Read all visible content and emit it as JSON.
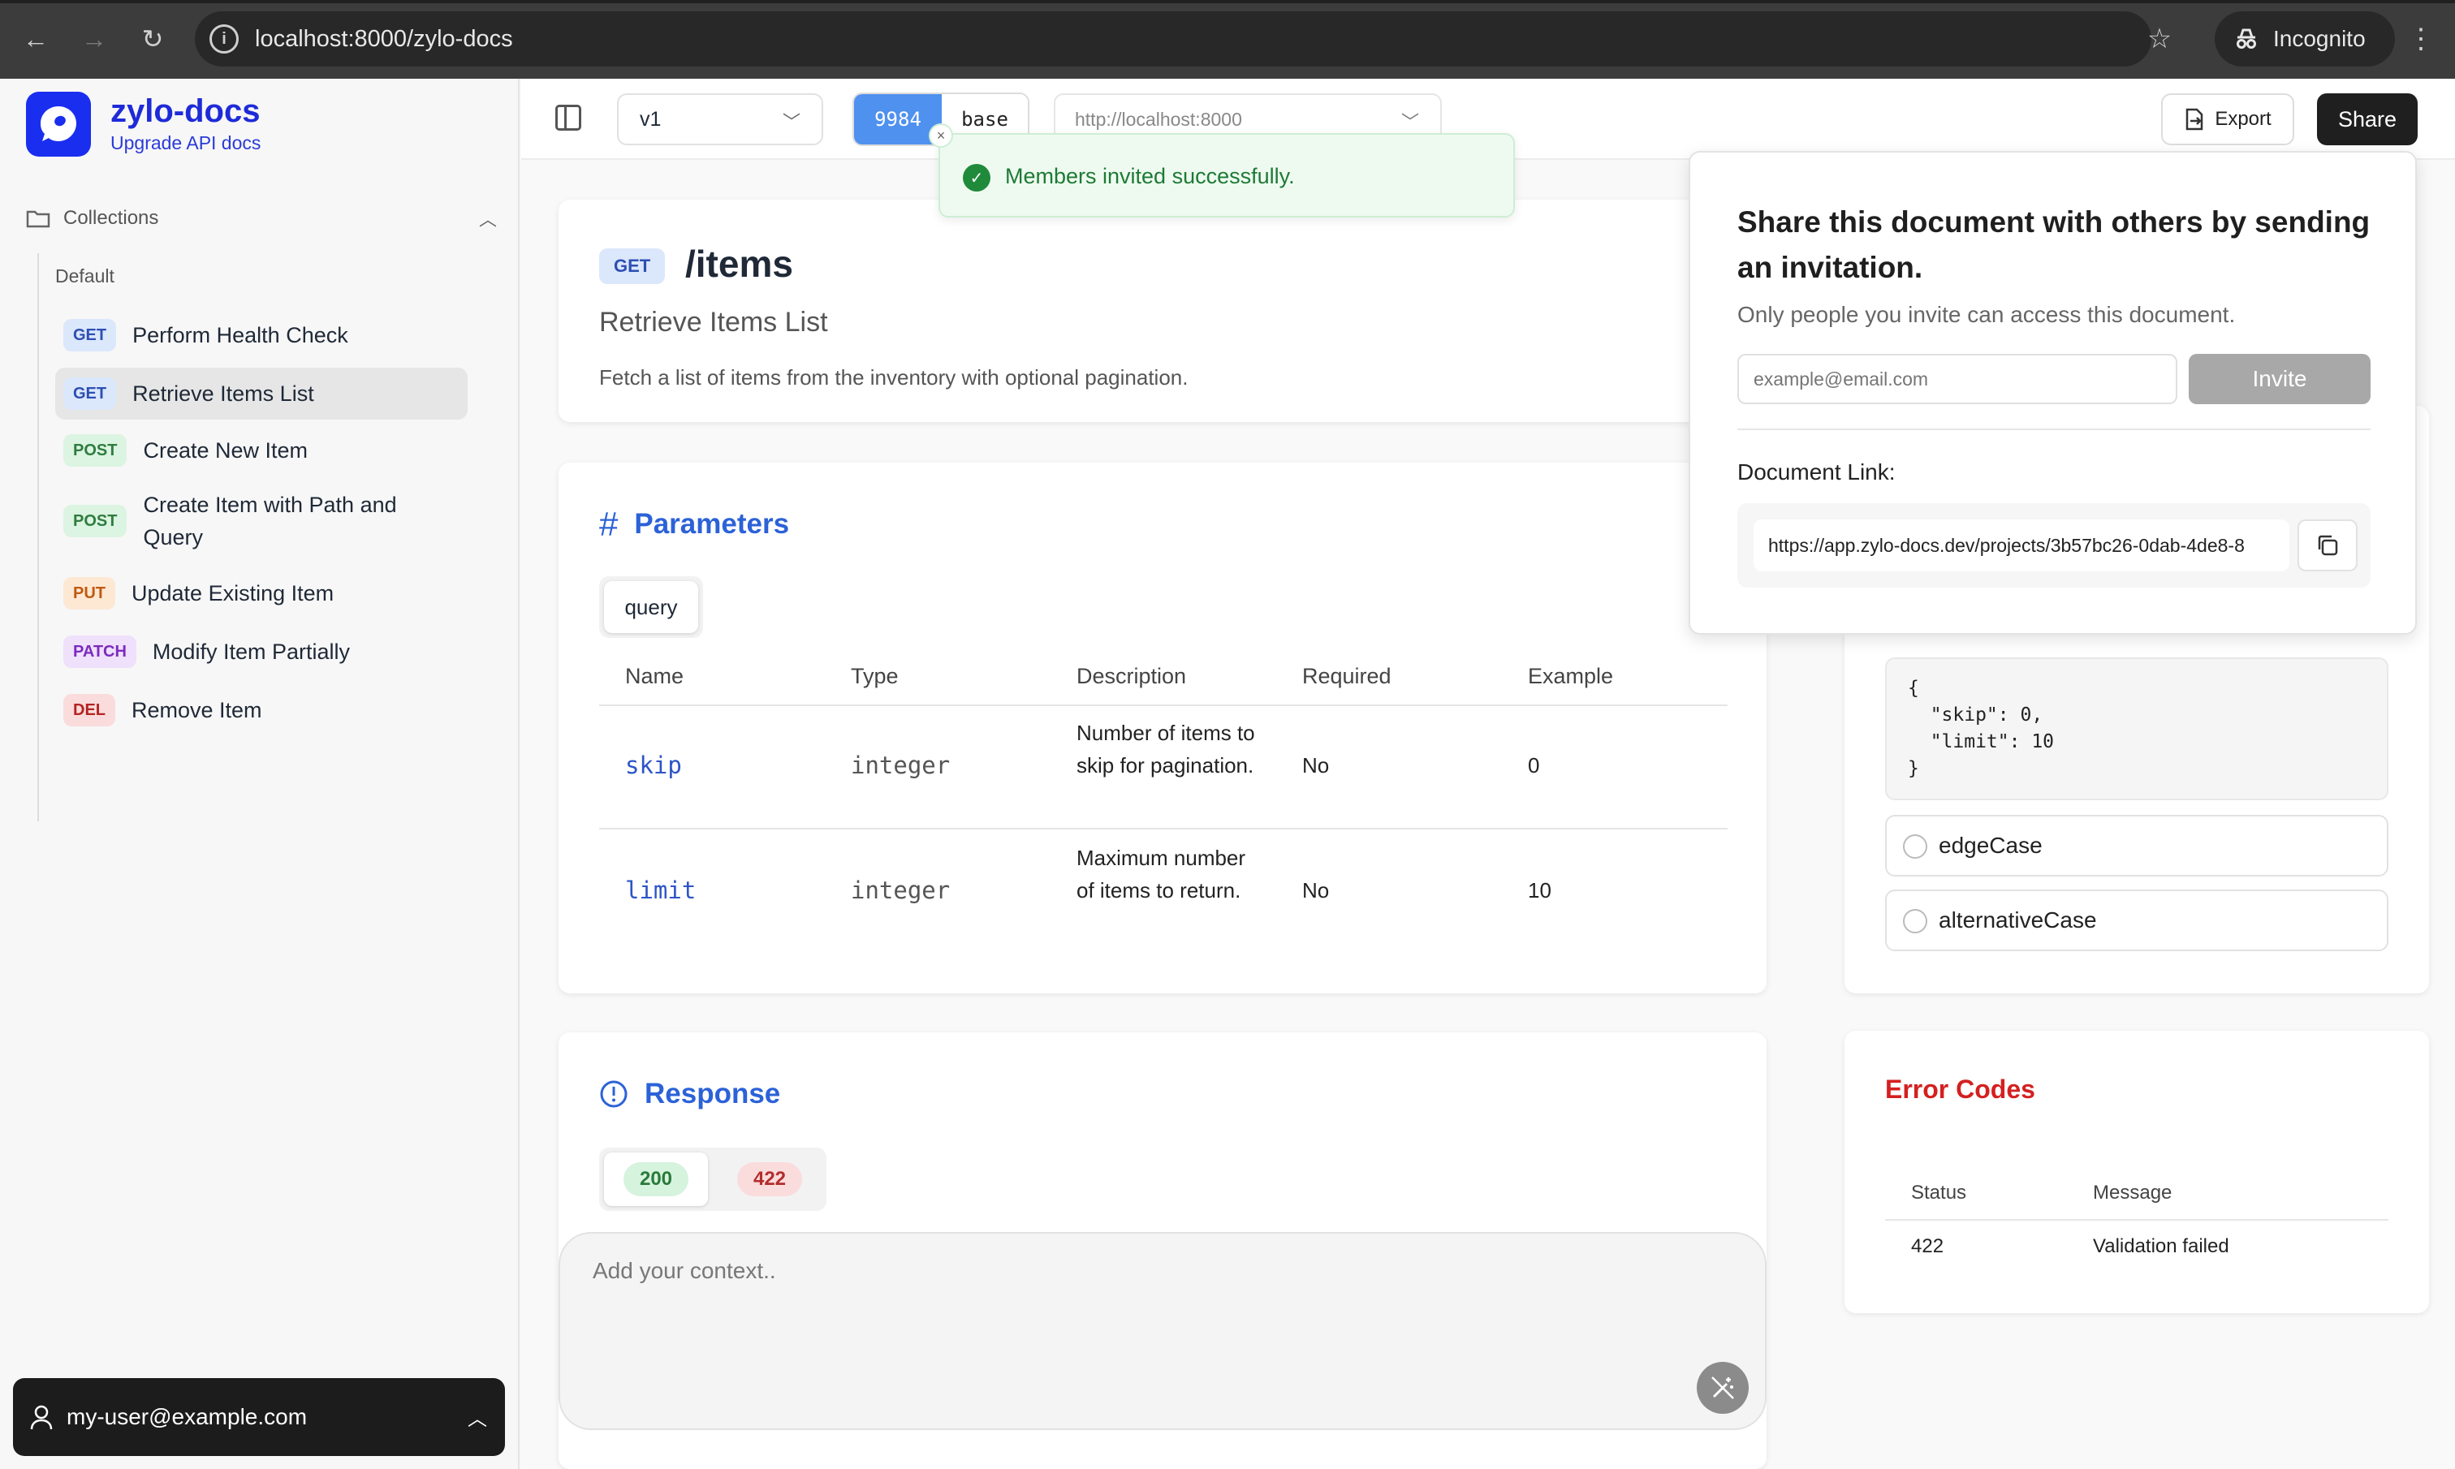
{
  "browser": {
    "url": "localhost:8000/zylo-docs",
    "incognito_label": "Incognito"
  },
  "sidebar": {
    "brand": "zylo-docs",
    "brand_sub": "Upgrade API docs",
    "collections_label": "Collections",
    "group_label": "Default",
    "endpoints": [
      {
        "method": "GET",
        "label": "Perform Health Check"
      },
      {
        "method": "GET",
        "label": "Retrieve Items List"
      },
      {
        "method": "POST",
        "label": "Create New Item"
      },
      {
        "method": "POST",
        "label": "Create Item with Path and Query"
      },
      {
        "method": "PUT",
        "label": "Update Existing Item"
      },
      {
        "method": "PATCH",
        "label": "Modify Item Partially"
      },
      {
        "method": "DEL",
        "label": "Remove Item"
      }
    ],
    "user_email": "my-user@example.com"
  },
  "topbar": {
    "version": "v1",
    "env_id": "9984",
    "env_name": "base",
    "base_url": "http://localhost:8000",
    "export_label": "Export",
    "share_label": "Share"
  },
  "toast": {
    "message": "Members invited successfully."
  },
  "endpoint": {
    "method": "GET",
    "path": "/items",
    "summary": "Retrieve Items List",
    "description": "Fetch a list of items from the inventory with optional pagination."
  },
  "parameters": {
    "title": "Parameters",
    "tab": "query",
    "columns": [
      "Name",
      "Type",
      "Description",
      "Required",
      "Example"
    ],
    "rows": [
      {
        "name": "skip",
        "type": "integer",
        "description": "Number of items to skip for pagination.",
        "required": "No",
        "example": "0"
      },
      {
        "name": "limit",
        "type": "integer",
        "description": "Maximum number of items to return.",
        "required": "No",
        "example": "10"
      }
    ]
  },
  "response": {
    "title": "Response",
    "tabs": [
      "200",
      "422"
    ],
    "context_placeholder": "Add your context.."
  },
  "examples": {
    "json": "{\n  \"skip\": 0,\n  \"limit\": 10\n}",
    "cases": [
      "edgeCase",
      "alternativeCase"
    ]
  },
  "error_codes": {
    "title": "Error Codes",
    "columns": [
      "Status",
      "Message"
    ],
    "rows": [
      {
        "status": "422",
        "message": "Validation failed"
      }
    ]
  },
  "share_popover": {
    "title": "Share this document with others by sending an invitation.",
    "subtitle": "Only people you invite can access this document.",
    "email_placeholder": "example@email.com",
    "invite_label": "Invite",
    "link_label": "Document Link:",
    "link": "https://app.zylo-docs.dev/projects/3b57bc26-0dab-4de8-8"
  }
}
